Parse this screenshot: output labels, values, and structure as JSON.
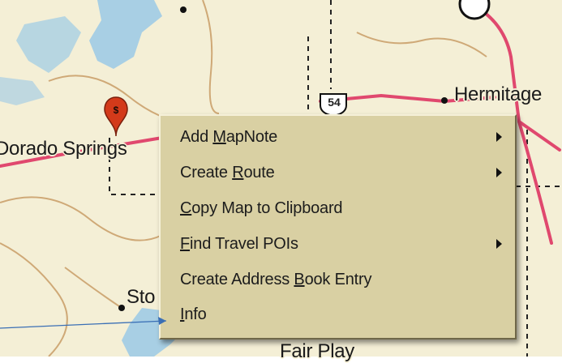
{
  "map": {
    "labels": {
      "dorado_springs": "Dorado Springs",
      "hermitage": "Hermitage",
      "stockton": "Sto",
      "fair_play": "Fair Play",
      "route_shield": "54"
    }
  },
  "context_menu": {
    "items": [
      {
        "pre": "Add ",
        "key": "M",
        "post": "apNote",
        "submenu": true
      },
      {
        "pre": "Create ",
        "key": "R",
        "post": "oute",
        "submenu": true
      },
      {
        "pre": "",
        "key": "C",
        "post": "opy Map to Clipboard",
        "submenu": false
      },
      {
        "pre": "",
        "key": "F",
        "post": "ind Travel POIs",
        "submenu": true
      },
      {
        "pre": "Create Address ",
        "key": "B",
        "post": "ook Entry",
        "submenu": false
      },
      {
        "pre": "",
        "key": "I",
        "post": "nfo",
        "submenu": false
      }
    ]
  },
  "colors": {
    "map_background": "#f4efd6",
    "highway": "#e0486e",
    "water": "#a8cfe4",
    "county_border": "#cfa977",
    "menu_background": "#d9d0a3",
    "pin": "#d33a1a",
    "annotation_arrow": "#3a6fb5"
  },
  "icons": {
    "pin": "map-pin-icon",
    "submenu": "submenu-arrow-icon",
    "shield": "us-route-shield-icon"
  }
}
